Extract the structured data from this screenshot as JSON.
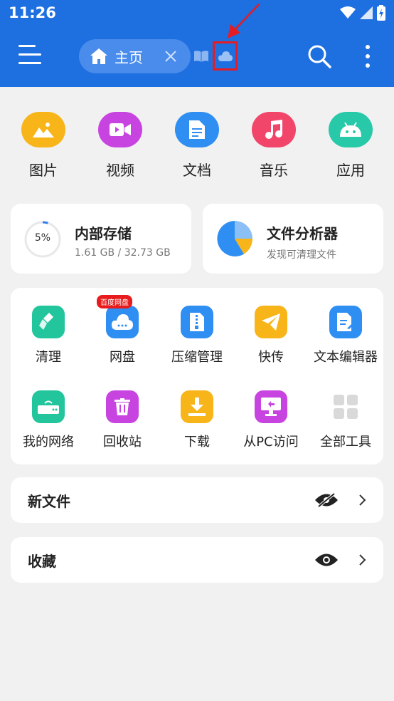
{
  "status_bar": {
    "time": "11:26"
  },
  "header": {
    "home_tab_label": "主页",
    "colors": {
      "primary": "#1e6fe0",
      "tab_bg": "#4a8ceb",
      "highlight": "#e51c23"
    }
  },
  "categories": [
    {
      "label": "图片",
      "icon": "image-icon",
      "color": "#f7b51a"
    },
    {
      "label": "视频",
      "icon": "video-icon",
      "color": "#c844e0"
    },
    {
      "label": "文档",
      "icon": "document-icon",
      "color": "#2f8ef2"
    },
    {
      "label": "音乐",
      "icon": "music-icon",
      "color": "#f2456a"
    },
    {
      "label": "应用",
      "icon": "android-icon",
      "color": "#27c9a8"
    }
  ],
  "storage": {
    "title": "内部存储",
    "percent": "5%",
    "usage": "1.61 GB / 32.73 GB",
    "fill_fraction": 0.05
  },
  "analyzer": {
    "title": "文件分析器",
    "subtitle": "发现可清理文件"
  },
  "tools": [
    {
      "label": "清理",
      "icon": "broom-icon",
      "color": "#22c59c"
    },
    {
      "label": "网盘",
      "icon": "cloud-disk-icon",
      "color": "#2f8ef2",
      "badge": "百度网盘"
    },
    {
      "label": "压缩管理",
      "icon": "zip-icon",
      "color": "#2f8ef2"
    },
    {
      "label": "快传",
      "icon": "send-icon",
      "color": "#f7b51a"
    },
    {
      "label": "文本编辑器",
      "icon": "edit-icon",
      "color": "#2f8ef2"
    },
    {
      "label": "我的网络",
      "icon": "router-icon",
      "color": "#22c59c"
    },
    {
      "label": "回收站",
      "icon": "trash-icon",
      "color": "#c844e0"
    },
    {
      "label": "下载",
      "icon": "download-icon",
      "color": "#f7b51a"
    },
    {
      "label": "从PC访问",
      "icon": "pc-icon",
      "color": "#c844e0"
    },
    {
      "label": "全部工具",
      "icon": "grid-icon",
      "color": "#d9d9d9"
    }
  ],
  "new_files": {
    "title": "新文件"
  },
  "favorites": {
    "title": "收藏"
  }
}
